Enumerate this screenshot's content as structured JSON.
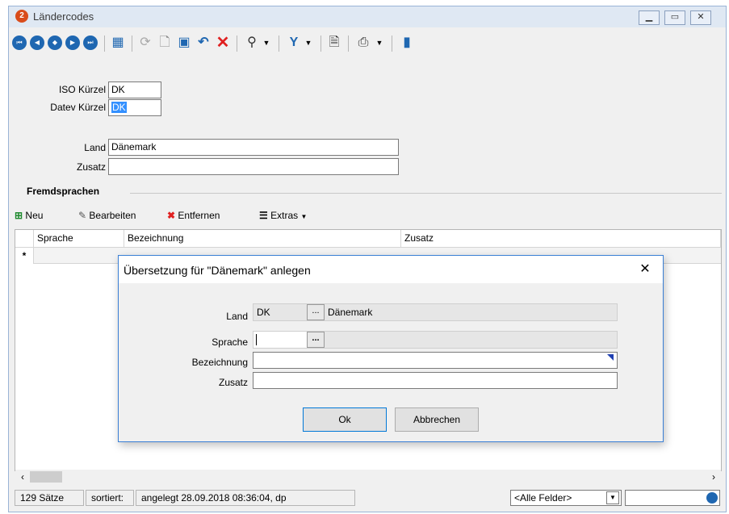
{
  "window": {
    "title": "Ländercodes",
    "icon_glyph": "2",
    "controls": [
      "minimize-icon",
      "maximize-icon",
      "close-icon"
    ]
  },
  "toolbar": {
    "icons": [
      "first-record-icon",
      "previous-page-icon",
      "previous-record-icon",
      "next-record-icon",
      "last-record-icon",
      "table-view-icon",
      "refresh-icon",
      "new-document-icon",
      "save-icon",
      "undo-icon",
      "delete-icon",
      "search-icon",
      "filter-icon",
      "report-icon",
      "print-icon",
      "exit-icon"
    ]
  },
  "form": {
    "iso_label": "ISO Kürzel",
    "iso_value": "DK",
    "datev_label": "Datev Kürzel",
    "datev_value": "DK",
    "land_label": "Land",
    "land_value": "Dänemark",
    "zusatz_label": "Zusatz",
    "zusatz_value": ""
  },
  "fremdsprachen": {
    "title": "Fremdsprachen",
    "toolbar": {
      "neu": "Neu",
      "bearbeiten": "Bearbeiten",
      "entfernen": "Entfernen",
      "extras": "Extras"
    },
    "columns": [
      "Sprache",
      "Bezeichnung",
      "Zusatz"
    ],
    "new_row_marker": "*"
  },
  "dialog": {
    "title": "Übersetzung für \"Dänemark\" anlegen",
    "land_label": "Land",
    "land_code": "DK",
    "land_name": "Dänemark",
    "sprache_label": "Sprache",
    "sprache_value": "",
    "bezeichnung_label": "Bezeichnung",
    "bezeichnung_value": "",
    "zusatz_label": "Zusatz",
    "zusatz_value": "",
    "browse_label": "...",
    "ok_label": "Ok",
    "cancel_label": "Abbrechen"
  },
  "status": {
    "count": "129 Sätze",
    "sort": "sortiert:",
    "created": "angelegt 28.09.2018 08:36:04, dp",
    "field_filter": "<Alle Felder>",
    "search_value": ""
  },
  "colors": {
    "accent": "#1f67b1",
    "selection": "#3390ff",
    "dialog_border": "#3a7fd5",
    "delete_red": "#e02020"
  }
}
